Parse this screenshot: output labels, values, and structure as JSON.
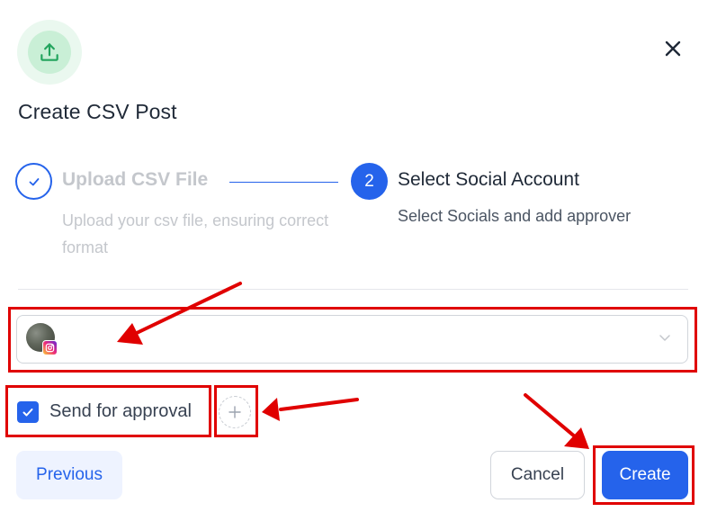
{
  "header": {
    "upload_icon": "upload-icon",
    "close_icon": "close-icon"
  },
  "modal": {
    "title": "Create CSV Post"
  },
  "steps": [
    {
      "number": "",
      "icon": "check-icon",
      "title": "Upload CSV File",
      "description": "Upload your csv file, ensuring correct format",
      "state": "completed"
    },
    {
      "number": "2",
      "title": "Select Social Account",
      "description": "Select Socials and add approver",
      "state": "active"
    }
  ],
  "account_select": {
    "selected_account_icon": "instagram-icon",
    "dropdown_icon": "chevron-down-icon"
  },
  "approval": {
    "label": "Send for approval",
    "checked": true,
    "add_icon": "plus-icon"
  },
  "footer": {
    "previous_label": "Previous",
    "cancel_label": "Cancel",
    "create_label": "Create"
  },
  "colors": {
    "primary": "#2563eb",
    "annotation": "#e00000",
    "upload_accent": "#22a45d"
  }
}
